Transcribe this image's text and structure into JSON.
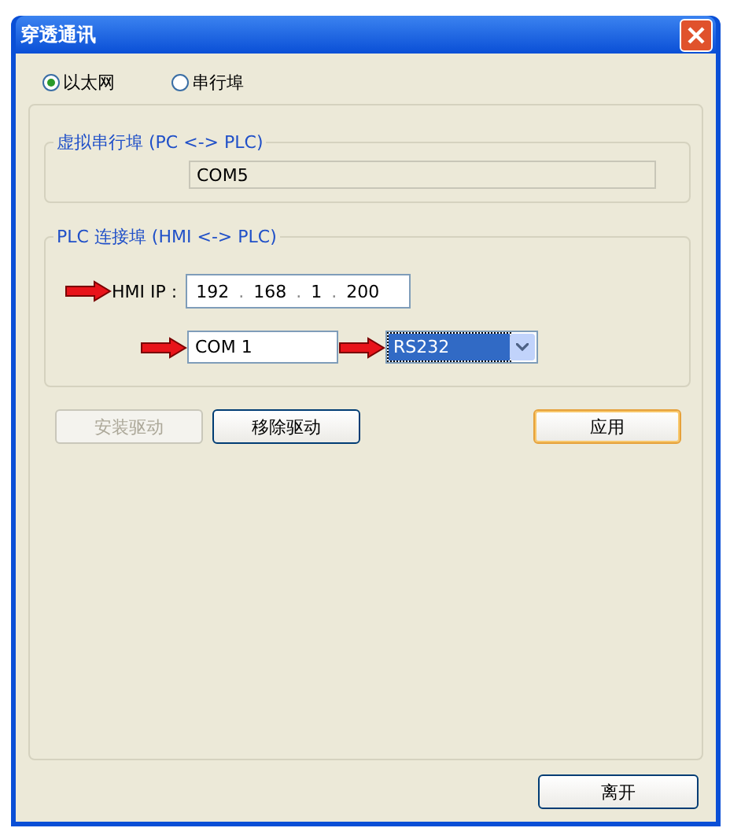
{
  "window": {
    "title": "穿透通讯"
  },
  "connection": [
    {
      "label": "以太网",
      "selected": true
    },
    {
      "label": "串行埠",
      "selected": false
    }
  ],
  "virtual_port": {
    "title": "虚拟串行埠 (PC <-> PLC)",
    "value": "COM5"
  },
  "plc_port": {
    "title": "PLC 连接埠 (HMI <-> PLC)",
    "ip_label": "HMI IP :",
    "ip": [
      "192",
      "168",
      "1",
      "200"
    ],
    "ip_separator": ".",
    "port": "COM 1",
    "protocol": {
      "value": "RS232",
      "selected": true
    }
  },
  "buttons": [
    {
      "label": "安装驱动",
      "disabled": true,
      "default": false
    },
    {
      "label": "移除驱动",
      "disabled": false,
      "default": false
    },
    {
      "label": "应用",
      "disabled": false,
      "default": true
    }
  ],
  "footer_button": {
    "label": "离开"
  }
}
